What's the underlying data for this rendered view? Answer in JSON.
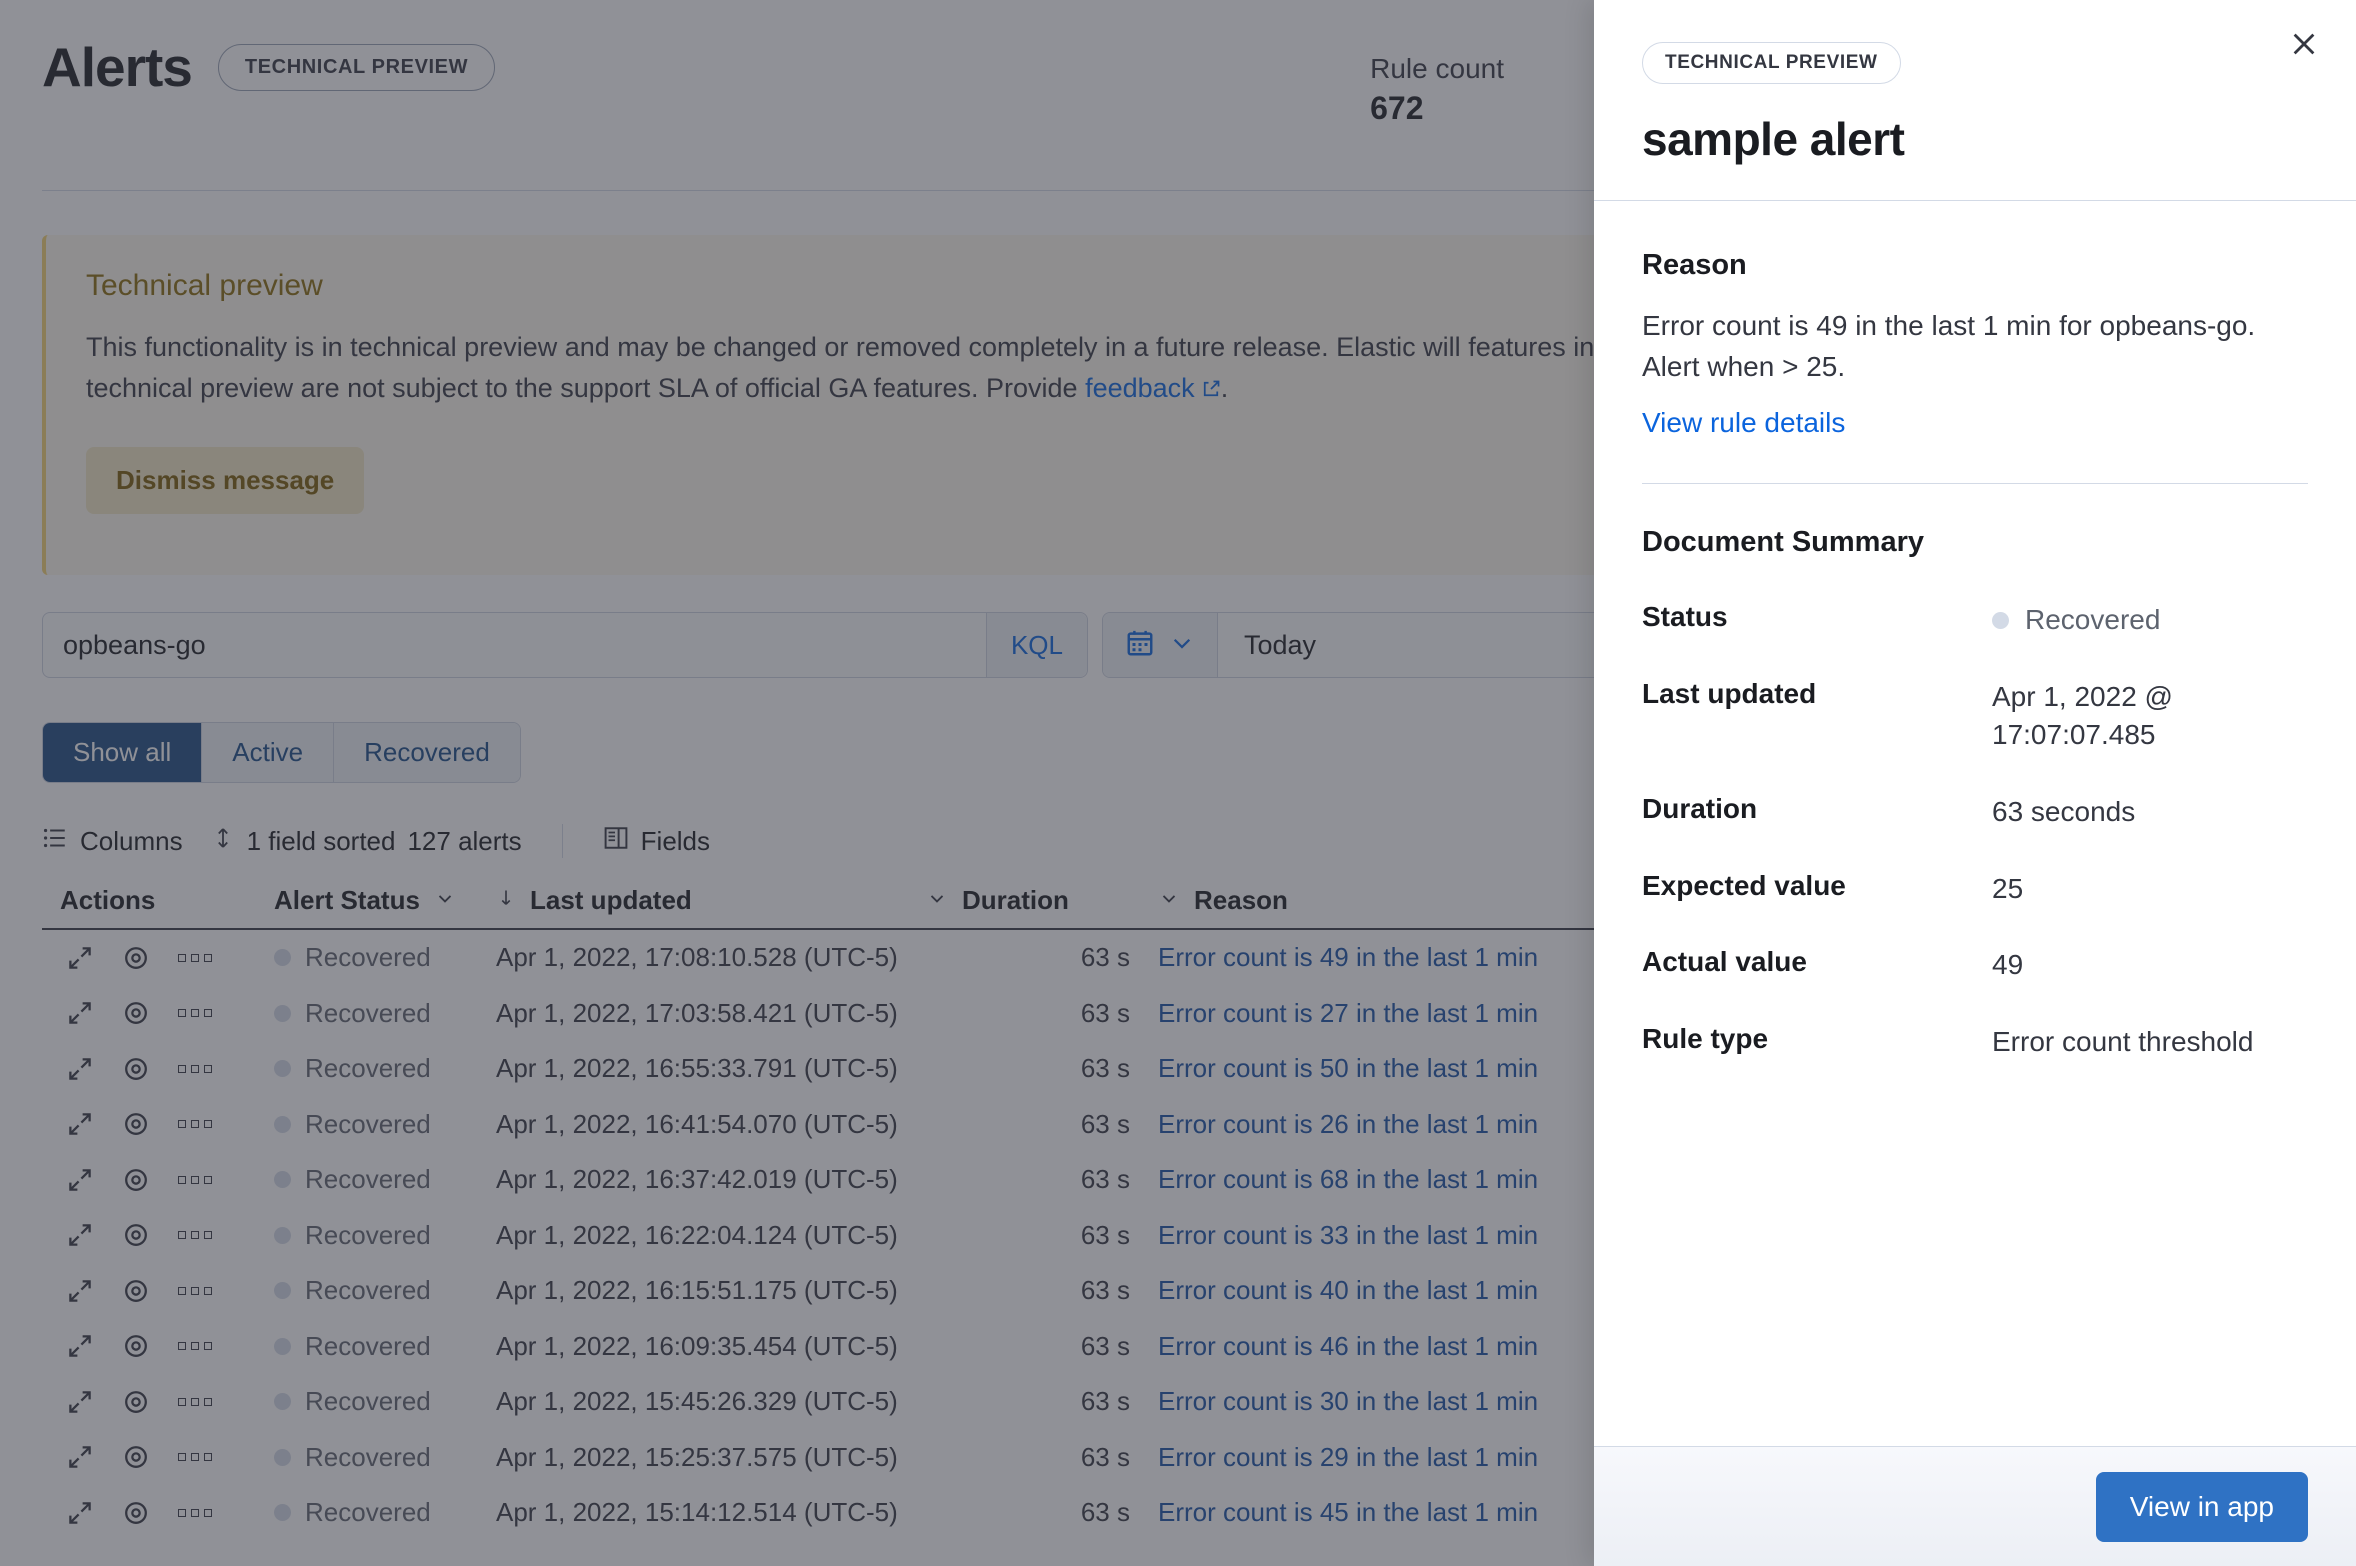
{
  "page": {
    "title": "Alerts",
    "badge": "TECHNICAL PREVIEW",
    "rule_count_label": "Rule count",
    "rule_count_value": "672"
  },
  "callout": {
    "title": "Technical preview",
    "body_part1": "This functionality is in technical preview and may be changed or removed completely in a future release. Elastic will",
    "body_part2": "features in technical preview are not subject to the support SLA of official GA features. Provide",
    "link": "feedback",
    "period": ".",
    "dismiss_label": "Dismiss message"
  },
  "search": {
    "query_value": "opbeans-go",
    "query_language": "KQL",
    "date_value": "Today"
  },
  "filters": [
    {
      "label": "Show all",
      "active": true
    },
    {
      "label": "Active",
      "active": false
    },
    {
      "label": "Recovered",
      "active": false
    }
  ],
  "toolbar": {
    "columns_label": "Columns",
    "sort_label": "1 field sorted",
    "count_label": "127 alerts",
    "fields_label": "Fields"
  },
  "grid": {
    "columns": [
      "Actions",
      "Alert Status",
      "Last updated",
      "Duration",
      "Reason"
    ],
    "rows": [
      {
        "status": "Recovered",
        "updated": "Apr 1, 2022, 17:08:10.528 (UTC-5)",
        "duration": "63 s",
        "reason": "Error count is 49 in the last 1 min"
      },
      {
        "status": "Recovered",
        "updated": "Apr 1, 2022, 17:03:58.421 (UTC-5)",
        "duration": "63 s",
        "reason": "Error count is 27 in the last 1 min"
      },
      {
        "status": "Recovered",
        "updated": "Apr 1, 2022, 16:55:33.791 (UTC-5)",
        "duration": "63 s",
        "reason": "Error count is 50 in the last 1 min"
      },
      {
        "status": "Recovered",
        "updated": "Apr 1, 2022, 16:41:54.070 (UTC-5)",
        "duration": "63 s",
        "reason": "Error count is 26 in the last 1 min"
      },
      {
        "status": "Recovered",
        "updated": "Apr 1, 2022, 16:37:42.019 (UTC-5)",
        "duration": "63 s",
        "reason": "Error count is 68 in the last 1 min"
      },
      {
        "status": "Recovered",
        "updated": "Apr 1, 2022, 16:22:04.124 (UTC-5)",
        "duration": "63 s",
        "reason": "Error count is 33 in the last 1 min"
      },
      {
        "status": "Recovered",
        "updated": "Apr 1, 2022, 16:15:51.175 (UTC-5)",
        "duration": "63 s",
        "reason": "Error count is 40 in the last 1 min"
      },
      {
        "status": "Recovered",
        "updated": "Apr 1, 2022, 16:09:35.454 (UTC-5)",
        "duration": "63 s",
        "reason": "Error count is 46 in the last 1 min"
      },
      {
        "status": "Recovered",
        "updated": "Apr 1, 2022, 15:45:26.329 (UTC-5)",
        "duration": "63 s",
        "reason": "Error count is 30 in the last 1 min"
      },
      {
        "status": "Recovered",
        "updated": "Apr 1, 2022, 15:25:37.575 (UTC-5)",
        "duration": "63 s",
        "reason": "Error count is 29 in the last 1 min"
      },
      {
        "status": "Recovered",
        "updated": "Apr 1, 2022, 15:14:12.514 (UTC-5)",
        "duration": "63 s",
        "reason": "Error count is 45 in the last 1 min"
      }
    ]
  },
  "flyout": {
    "badge": "TECHNICAL PREVIEW",
    "title": "sample alert",
    "reason_heading": "Reason",
    "reason_text": "Error count is 49 in the last 1 min for opbeans-go. Alert when > 25.",
    "rule_link": "View rule details",
    "summary_heading": "Document Summary",
    "summary": [
      {
        "label": "Status",
        "value": "Recovered",
        "is_status": true
      },
      {
        "label": "Last updated",
        "value": "Apr 1, 2022 @ 17:07:07.485",
        "is_status": false
      },
      {
        "label": "Duration",
        "value": "63 seconds",
        "is_status": false
      },
      {
        "label": "Expected value",
        "value": "25",
        "is_status": false
      },
      {
        "label": "Actual value",
        "value": "49",
        "is_status": false
      },
      {
        "label": "Rule type",
        "value": "Error count threshold",
        "is_status": false
      }
    ],
    "footer_button": "View in app"
  },
  "colors": {
    "accent_blue": "#0b64dd",
    "primary_button": "#2f72c4",
    "status_recovered_dot": "#d3dae6",
    "callout_border": "#f3d371",
    "active_filter": "#1b4b80"
  }
}
